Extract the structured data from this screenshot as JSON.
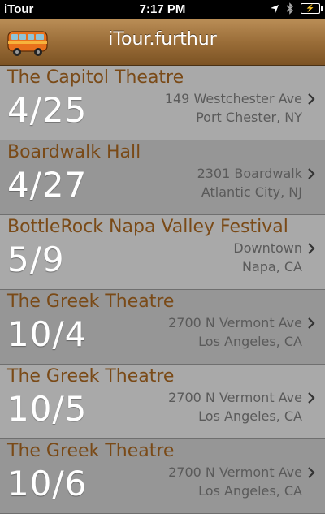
{
  "status_bar": {
    "carrier": "iTour",
    "time": "7:17 PM"
  },
  "nav": {
    "title": "iTour.furthur",
    "logo_icon": "van-icon"
  },
  "colors": {
    "accent": "#7a4a17",
    "nav_bar": "#9a6d38",
    "row_light": "#a9a9a9",
    "row_dark": "#969696"
  },
  "events": [
    {
      "venue": "The Capitol Theatre",
      "date": "4/25",
      "address": "149 Westchester Ave",
      "city": "Port Chester, NY"
    },
    {
      "venue": "Boardwalk Hall",
      "date": "4/27",
      "address": "2301 Boardwalk",
      "city": "Atlantic City, NJ"
    },
    {
      "venue": "BottleRock Napa Valley Festival",
      "date": "5/9",
      "address": "Downtown",
      "city": "Napa, CA"
    },
    {
      "venue": "The Greek Theatre",
      "date": "10/4",
      "address": "2700 N Vermont Ave",
      "city": "Los Angeles, CA"
    },
    {
      "venue": "The Greek Theatre",
      "date": "10/5",
      "address": "2700 N Vermont Ave",
      "city": "Los Angeles, CA"
    },
    {
      "venue": "The Greek Theatre",
      "date": "10/6",
      "address": "2700 N Vermont Ave",
      "city": "Los Angeles, CA"
    }
  ]
}
